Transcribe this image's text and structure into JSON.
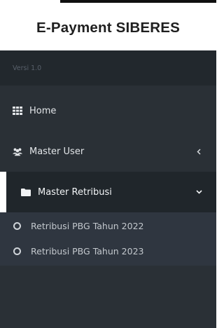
{
  "app": {
    "title": "E-Payment SIBERES",
    "version": "Versi 1.0"
  },
  "sidebar": {
    "items": [
      {
        "label": "Home",
        "icon": "grid-icon"
      },
      {
        "label": "Master User",
        "icon": "users-icon",
        "chevron": "chevron-left-icon"
      },
      {
        "label": "Master Retribusi",
        "icon": "folder-icon",
        "chevron": "chevron-down-icon",
        "active": true
      }
    ],
    "submenu": [
      {
        "label": "Retribusi PBG Tahun 2022",
        "icon": "circle-icon"
      },
      {
        "label": "Retribusi PBG Tahun 2023",
        "icon": "circle-icon"
      }
    ]
  },
  "colors": {
    "sidebar_bg": "#2a3036",
    "version_bg": "#22282d",
    "active_bg": "#20262b",
    "submenu_bg": "#2f3640",
    "accent": "#ffffff",
    "text": "#e3e6e9"
  }
}
